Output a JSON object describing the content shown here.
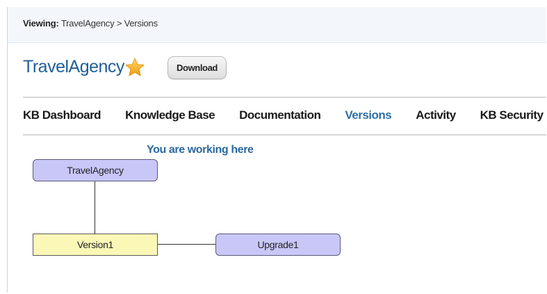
{
  "breadcrumb": {
    "label": "Viewing:",
    "path": "TravelAgency > Versions"
  },
  "header": {
    "title": "TravelAgency",
    "star_icon": "star-icon",
    "download_label": "Download"
  },
  "nav": {
    "tabs": [
      {
        "label": "KB Dashboard",
        "active": false
      },
      {
        "label": "Knowledge Base",
        "active": false
      },
      {
        "label": "Documentation",
        "active": false
      },
      {
        "label": "Versions",
        "active": true
      },
      {
        "label": "Activity",
        "active": false
      },
      {
        "label": "KB Security",
        "active": false
      }
    ]
  },
  "diagram": {
    "working_here": "You are working here",
    "nodes": {
      "kb": "TravelAgency",
      "version": "Version1",
      "upgrade": "Upgrade1"
    }
  },
  "colors": {
    "accent": "#1f5f99",
    "active_tab": "#2f6ea6",
    "node_purple": "#c9c7f8",
    "node_yellow": "#fbf8b7",
    "star": "#f4b52c"
  }
}
